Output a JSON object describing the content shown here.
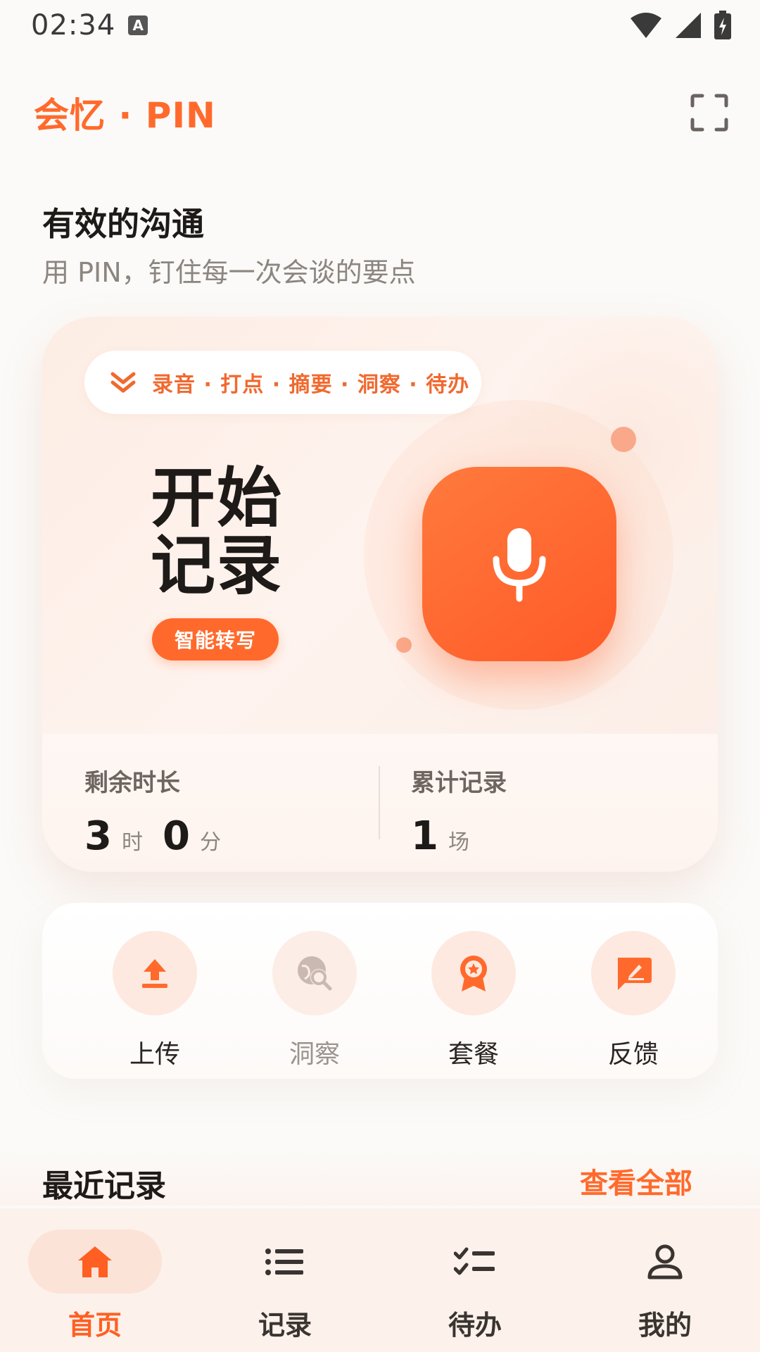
{
  "status_bar": {
    "time": "02:34",
    "notification_letter": "A"
  },
  "header": {
    "app_title": "会忆 · PIN"
  },
  "intro": {
    "title": "有效的沟通",
    "subtitle": "用 PIN，钉住每一次会谈的要点"
  },
  "record_card": {
    "features": "录音 · 打点 · 摘要 · 洞察 · 待办",
    "start_title": "开始记录",
    "tag": "智能转写",
    "stats": {
      "remaining_label": "剩余时长",
      "remaining_hours": "3",
      "hours_unit": "时",
      "remaining_minutes": "0",
      "minutes_unit": "分",
      "total_label": "累计记录",
      "total_count": "1",
      "count_unit": "场"
    }
  },
  "quick_actions": [
    {
      "label": "上传",
      "icon": "upload-icon"
    },
    {
      "label": "洞察",
      "icon": "insight-icon"
    },
    {
      "label": "套餐",
      "icon": "badge-icon"
    },
    {
      "label": "反馈",
      "icon": "feedback-icon"
    }
  ],
  "recent": {
    "title": "最近记录",
    "see_all": "查看全部"
  },
  "bottom_nav": [
    {
      "label": "首页",
      "icon": "home-icon",
      "active": true
    },
    {
      "label": "记录",
      "icon": "list-icon",
      "active": false
    },
    {
      "label": "待办",
      "icon": "checklist-icon",
      "active": false
    },
    {
      "label": "我的",
      "icon": "person-icon",
      "active": false
    }
  ],
  "colors": {
    "accent": "#FF6A2C",
    "accent_light": "#FDE9DF",
    "text_primary": "#1E1A18",
    "text_secondary": "#8C8580"
  }
}
